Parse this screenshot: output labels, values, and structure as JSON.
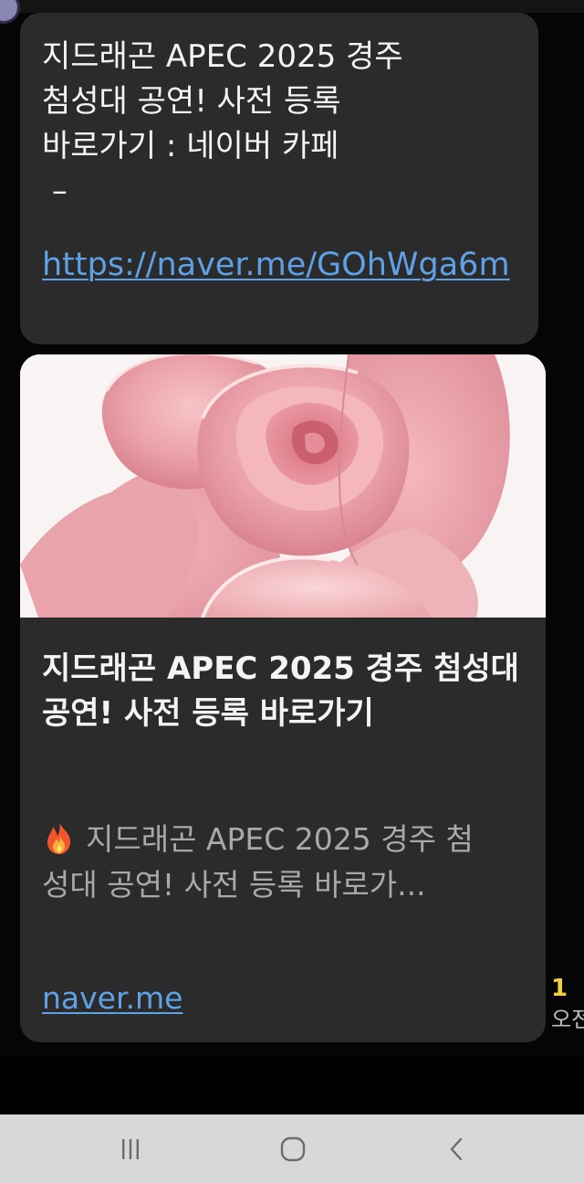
{
  "message": {
    "text": "지드래곤 APEC 2025 경주\n첨성대 공연! 사전 등록\n바로가기 : 네이버 카페\n –",
    "link": "https://naver.me/GOhWga6m"
  },
  "link_preview": {
    "image_alt": "pink-rose",
    "title": "지드래곤 APEC 2025 경주 첨성대 공연! 사전 등록 바로가기",
    "description_icon": "fire-emoji",
    "description": "지드래곤 APEC 2025 경주 첨성대 공연! 사전 등록 바로가...",
    "domain": "naver.me"
  },
  "meta": {
    "unread_count": "1",
    "time_partial": "오전"
  },
  "navigation": {
    "recent_apps": "recent-apps-icon",
    "home": "home-icon",
    "back": "back-icon"
  },
  "colors": {
    "bubble": "#2b2b2c",
    "link": "#5ea1e6",
    "unread_count": "#f2d23c",
    "nav_bar": "#d8d8d8"
  }
}
